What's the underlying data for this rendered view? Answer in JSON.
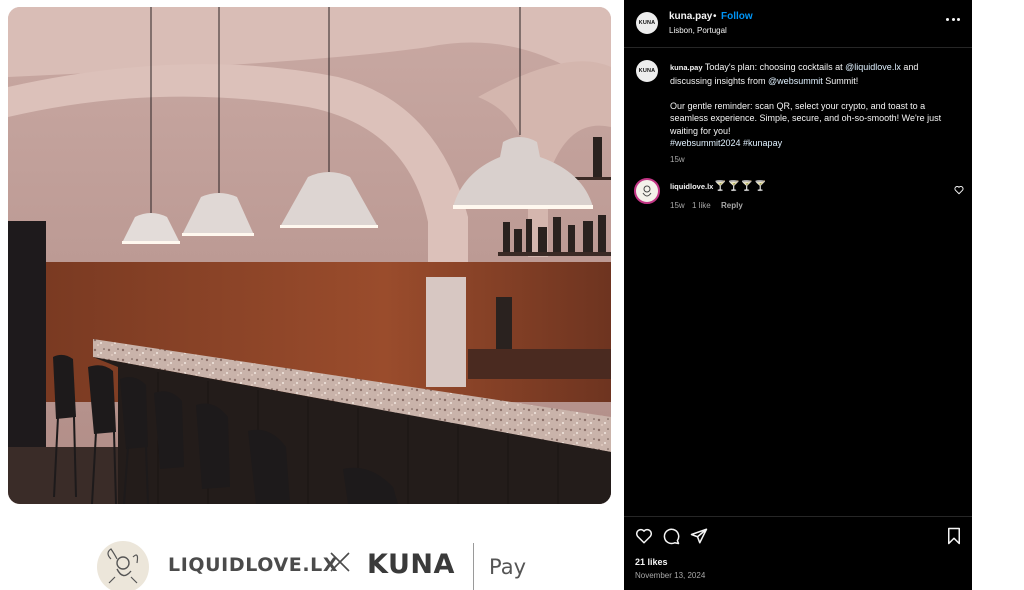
{
  "post": {
    "username": "kuna.pay",
    "follow_label": "Follow",
    "separator": "•",
    "location": "Lisbon, Portugal",
    "avatar_label": "KUNA",
    "more_icon": "more-horizontal-icon",
    "caption": {
      "username": "kuna.pay",
      "line1_text_a": "Today's plan: choosing cocktails at ",
      "mention_liquidlove": "@liquidlove.lx",
      "line1_text_b": " and discussing insights from ",
      "mention_websummit": "@websummit",
      "line1_text_c": " Summit!",
      "paragraph2": "Our gentle reminder: scan QR, select your crypto, and toast to a seamless experience. Simple, secure, and oh-so-smooth! We're just waiting for you!",
      "hashtags": "#websummit2024 #kunapay",
      "time": "15w"
    },
    "comment": {
      "username": "liquidlove.lx",
      "text": "🍸🍸🍸🍸",
      "time": "15w",
      "likes": "1 like",
      "reply_label": "Reply"
    },
    "likes_label": "21 likes",
    "date_label": "November 13, 2024"
  },
  "banner": {
    "brand_left": "LIQUIDLOVE.LX",
    "cross": "×",
    "brand_right": "KUNA",
    "brand_suffix": "Pay"
  },
  "colors": {
    "panel_bg": "#000000",
    "link_blue": "#0095f6",
    "muted": "#a8a8a8",
    "mention": "#e0f1ff"
  }
}
